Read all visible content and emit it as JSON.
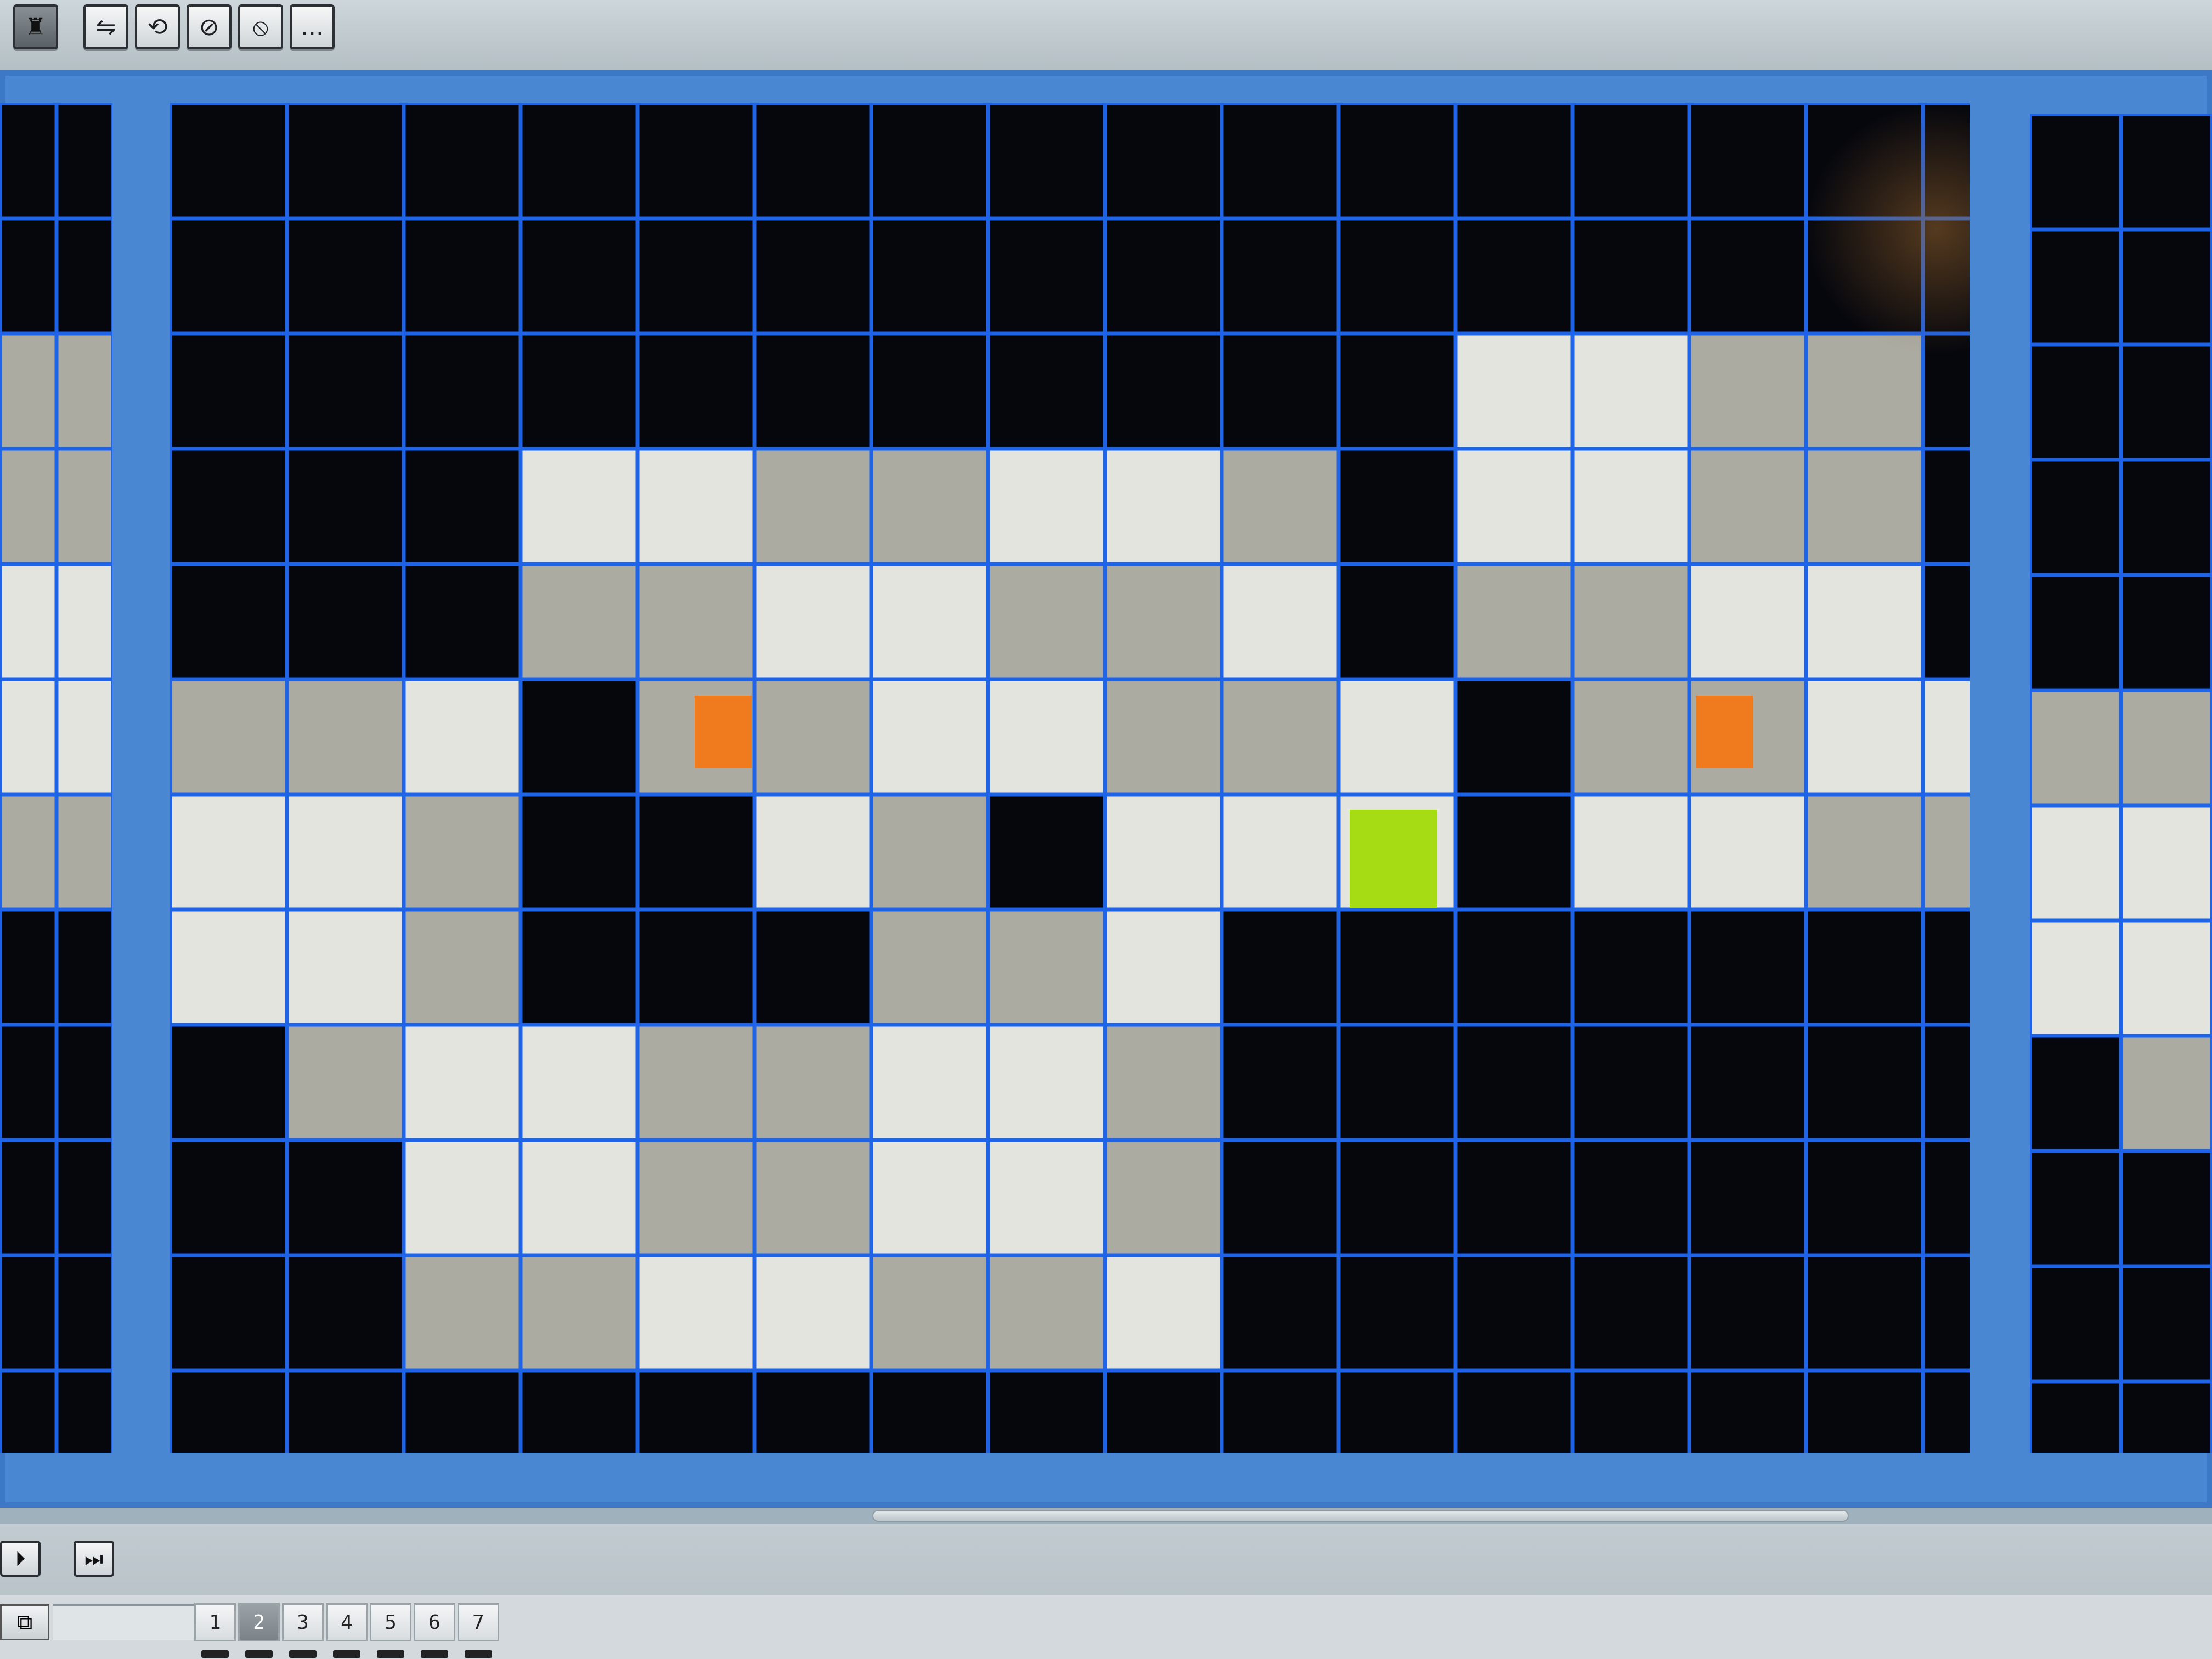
{
  "toolbar": {
    "buttons": [
      {
        "name": "stamp-tool-button",
        "icon": "stamp-icon",
        "glyph": "♜"
      },
      {
        "name": "flip-horizontal-button",
        "icon": "flip-horizontal-icon",
        "glyph": "⇋"
      },
      {
        "name": "rotate-button",
        "icon": "rotate-icon",
        "glyph": "⟲"
      },
      {
        "name": "no-rotate-button",
        "icon": "circle-slash-icon",
        "glyph": "⊘"
      },
      {
        "name": "no-flip-button",
        "icon": "circle-slash-icon",
        "glyph": "⦸"
      },
      {
        "name": "more-button",
        "icon": "ellipsis-icon",
        "glyph": "..."
      }
    ]
  },
  "palette": {
    "B": "#06070d",
    "W": "#e3e4de",
    "G": "#ababa2",
    "grid_line": "#1f63e6",
    "sprite_orange": "#f07a1e",
    "sprite_green": "#a6dc14"
  },
  "map": {
    "main_rows": [
      "BBBBBBBBBBBBBBBB",
      "BBBBBBBBBBBBBBBB",
      "BBBBBBBBBBBWWGGB",
      "BBBWWGGWWGBWWGGB",
      "BBBGGWWGGWBGGWWB",
      "GGWBGGWWGGWBGGWW",
      "WWGBBWGBWWWBWWGG",
      "WWGBBBGGWBBBBBBB",
      "BGWWGGWWGBBBBBBB",
      "BBWWGGWWGBBBBBBB",
      "BBGGWWGGWBBBBBBB",
      "BBBBBBBBBBBBBBBB"
    ],
    "left_rows": [
      "BB",
      "BB",
      "GG",
      "GG",
      "WW",
      "WW",
      "GG",
      "BB",
      "BB",
      "BB",
      "BB",
      "BB"
    ],
    "right_rows": [
      "BB",
      "BB",
      "BB",
      "BB",
      "BB",
      "GG",
      "WW",
      "WW",
      "BG",
      "BB",
      "BB",
      "BB"
    ],
    "sprites": [
      {
        "name": "orange-sprite-1",
        "color": "orange",
        "col": 4,
        "row": 5
      },
      {
        "name": "orange-sprite-2",
        "color": "orange",
        "col": 13,
        "row": 5
      },
      {
        "name": "green-sprite",
        "color": "green",
        "col": 10,
        "row": 6
      }
    ]
  },
  "playback": {
    "buttons": [
      {
        "name": "play-step-button",
        "icon": "play-step-icon",
        "glyph": "⏵"
      },
      {
        "name": "skip-end-button",
        "icon": "skip-end-icon",
        "glyph": "⏭"
      }
    ]
  },
  "layers": {
    "icon": "layers-icon",
    "tabs": [
      "1",
      "2",
      "3",
      "4",
      "5",
      "6",
      "7"
    ],
    "active_tab": "2"
  }
}
